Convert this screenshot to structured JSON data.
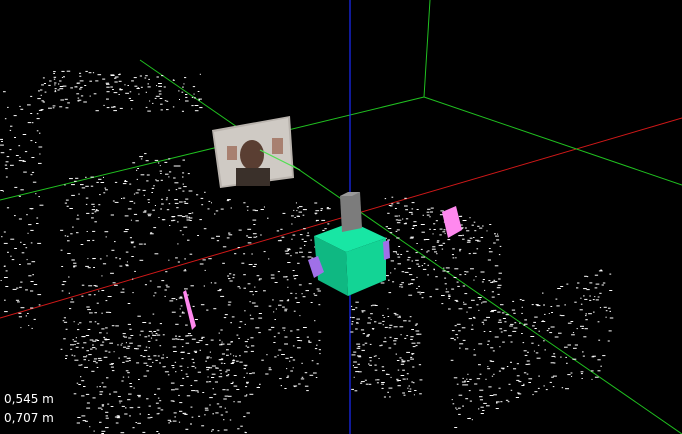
{
  "viewport": {
    "background": "#000000",
    "axis_colors": {
      "x": "#d01818",
      "y": "#20c020",
      "z": "#1a2cff"
    },
    "camera_feed_icon": "webcam-frame-image",
    "robot_colors": {
      "body": "#12d494",
      "sensor": "#808080",
      "side_panel": "#a070e8",
      "target_marker": "#ff88ee"
    }
  },
  "measurements": {
    "readout_1": "0,545 m",
    "readout_2": "0,707 m"
  }
}
